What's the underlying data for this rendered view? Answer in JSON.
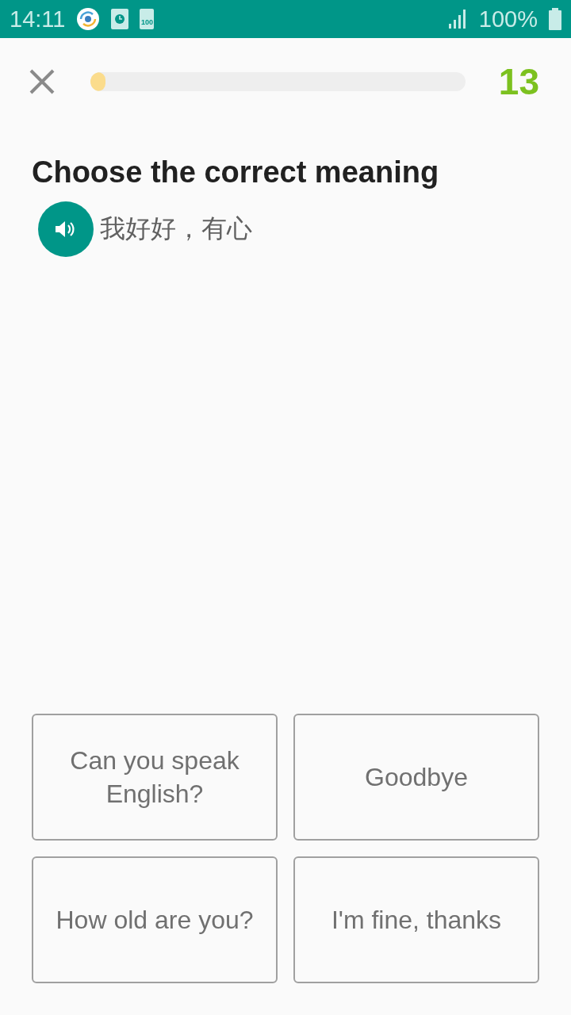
{
  "status_bar": {
    "time": "14:11",
    "battery_badge": "100",
    "battery_percent": "100%"
  },
  "header": {
    "progress": {
      "level": 0.04
    },
    "score": "13"
  },
  "prompt": {
    "title": "Choose the correct meaning",
    "phrase": "我好好，有心"
  },
  "options": [
    {
      "label": "Can you speak English?",
      "selected": false
    },
    {
      "label": "Goodbye",
      "selected": false
    },
    {
      "label": "How old are you?",
      "selected": false
    },
    {
      "label": "I'm fine, thanks",
      "selected": false
    }
  ]
}
